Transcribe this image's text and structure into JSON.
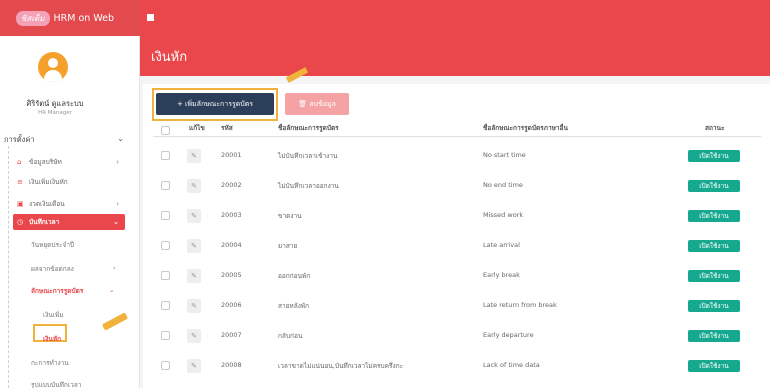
{
  "app": {
    "logo_text": "ซิสเต็ม",
    "name": "HRM on Web"
  },
  "page": {
    "title": "เงินหัก"
  },
  "user": {
    "name": "ศิริรัตน์ ดูแลระบบ",
    "role": "HR Manager"
  },
  "sidebar": {
    "section_label": "การตั้งค่า",
    "items": [
      {
        "label": "ข้อมูลบริษัท",
        "icon": "home-icon"
      },
      {
        "label": "เงินเพิ่มเงินหัก",
        "icon": "list-icon"
      },
      {
        "label": "งวดเงินเดือน",
        "icon": "calendar-icon"
      },
      {
        "label": "บันทึกเวลา",
        "icon": "clock-icon"
      },
      {
        "label": "วันหยุดประจำปี"
      },
      {
        "label": "ผลจากข้อตกลง"
      },
      {
        "label": "ลักษณะการรูดบัตร"
      },
      {
        "label": "เงินเพิ่ม"
      },
      {
        "label": "เงินหัก"
      },
      {
        "label": "กะการทำงาน"
      },
      {
        "label": "รูปแบบบันทึกเวลา"
      }
    ]
  },
  "toolbar": {
    "add_label": "+ เพิ่มลักษณะการรูดบัตร",
    "delete_label": "🗑 ลบข้อมูล"
  },
  "table": {
    "headers": [
      "แก้ไข",
      "รหัส",
      "ชื่อลักษณะการรูดบัตร",
      "ชื่อลักษณะการรูดบัตรภาษาอื่น",
      "สถานะ"
    ],
    "rows": [
      {
        "code": "20001",
        "name_th": "ไม่บันทึกเวลาเข้างาน",
        "name_en": "No start time",
        "status": "เปิดใช้งาน"
      },
      {
        "code": "20002",
        "name_th": "ไม่บันทึกเวลาออกงาน",
        "name_en": "No end time",
        "status": "เปิดใช้งาน"
      },
      {
        "code": "20003",
        "name_th": "ขาดงาน",
        "name_en": "Missed work",
        "status": "เปิดใช้งาน"
      },
      {
        "code": "20004",
        "name_th": "มาสาย",
        "name_en": "Late arrival",
        "status": "เปิดใช้งาน"
      },
      {
        "code": "20005",
        "name_th": "ออกก่อนพัก",
        "name_en": "Early break",
        "status": "เปิดใช้งาน"
      },
      {
        "code": "20006",
        "name_th": "สายหลังพัก",
        "name_en": "Late return from break",
        "status": "เปิดใช้งาน"
      },
      {
        "code": "20007",
        "name_th": "กลับก่อน",
        "name_en": "Early departure",
        "status": "เปิดใช้งาน"
      },
      {
        "code": "20008",
        "name_th": "เวลาขาดไม่แน่นอน,บันทึกเวลาไม่ครบครึ่งกะ",
        "name_en": "Lack of time data",
        "status": "เปิดใช้งาน"
      }
    ]
  },
  "colors": {
    "brand": "#e9474b",
    "primary_button": "#2b3e5a",
    "status_badge": "#17a98f",
    "highlight": "#f0b23a"
  }
}
